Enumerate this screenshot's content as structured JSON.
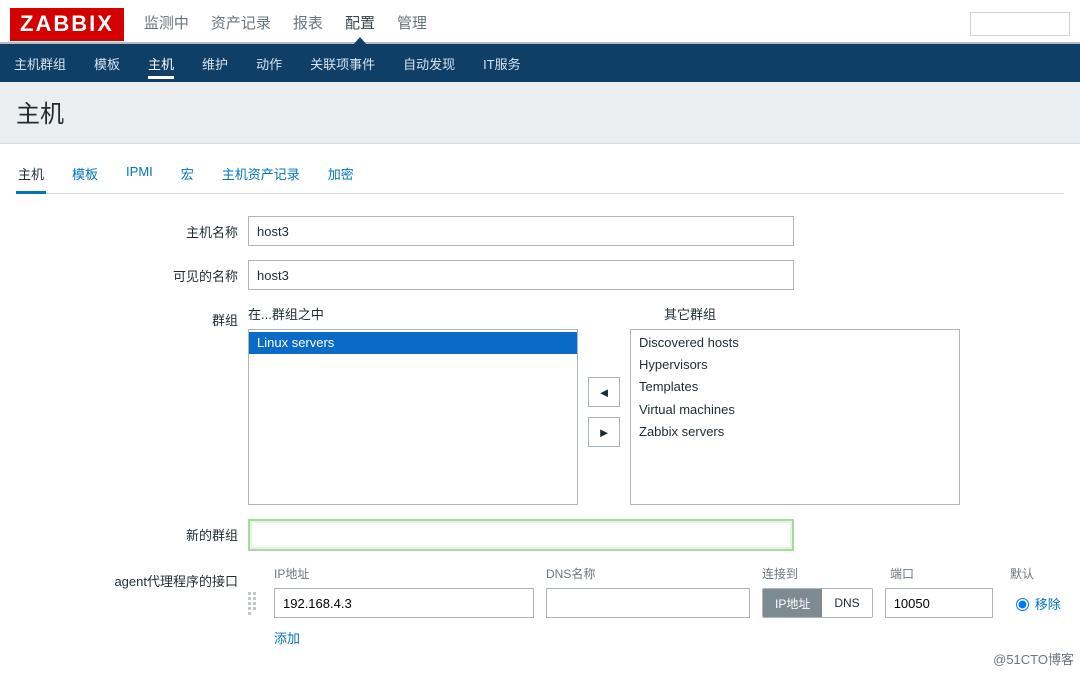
{
  "brand": "ZABBIX",
  "main_nav": {
    "items": [
      "监测中",
      "资产记录",
      "报表",
      "配置",
      "管理"
    ],
    "active_index": 3
  },
  "sub_nav": {
    "items": [
      "主机群组",
      "模板",
      "主机",
      "维护",
      "动作",
      "关联项事件",
      "自动发现",
      "IT服务"
    ],
    "active_index": 2
  },
  "page_title": "主机",
  "tabs": {
    "items": [
      "主机",
      "模板",
      "IPMI",
      "宏",
      "主机资产记录",
      "加密"
    ],
    "active_index": 0
  },
  "form": {
    "host_name_label": "主机名称",
    "host_name_value": "host3",
    "visible_name_label": "可见的名称",
    "visible_name_value": "host3",
    "groups_label": "群组",
    "in_groups_label": "在...群组之中",
    "other_groups_label": "其它群组",
    "in_groups": [
      "Linux servers"
    ],
    "in_groups_selected_index": 0,
    "other_groups": [
      "Discovered hosts",
      "Hypervisors",
      "Templates",
      "Virtual machines",
      "Zabbix servers"
    ],
    "move_left_icon": "◄",
    "move_right_icon": "►",
    "new_group_label": "新的群组",
    "new_group_value": "",
    "interfaces_label": "agent代理程序的接口",
    "iface_headers": {
      "ip": "IP地址",
      "dns": "DNS名称",
      "connect": "连接到",
      "port": "端口",
      "default": "默认"
    },
    "iface_row": {
      "ip": "192.168.4.3",
      "dns": "",
      "connect_ip_label": "IP地址",
      "connect_dns_label": "DNS",
      "connect_active": "ip",
      "port": "10050",
      "remove_label": "移除"
    },
    "add_label": "添加"
  },
  "watermark": "@51CTO博客"
}
